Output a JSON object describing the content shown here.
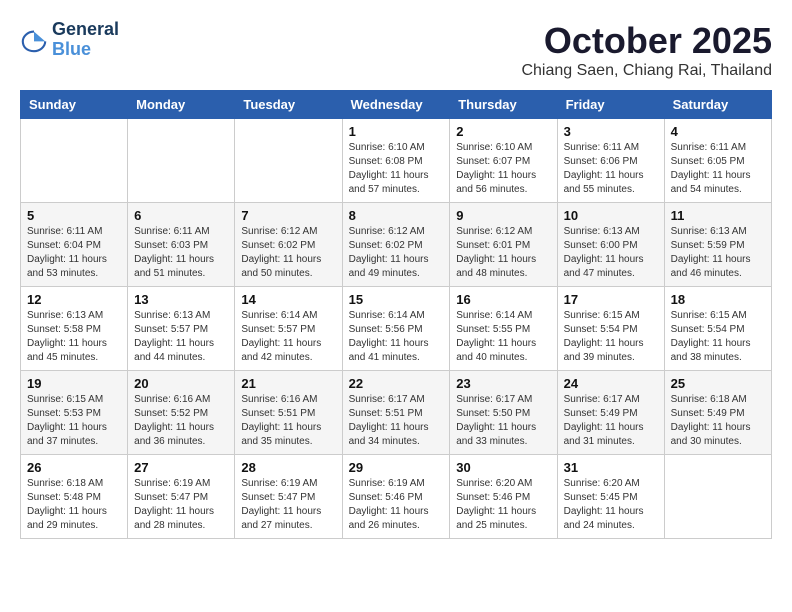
{
  "header": {
    "logo_line1": "General",
    "logo_line2": "Blue",
    "month": "October 2025",
    "location": "Chiang Saen, Chiang Rai, Thailand"
  },
  "weekdays": [
    "Sunday",
    "Monday",
    "Tuesday",
    "Wednesday",
    "Thursday",
    "Friday",
    "Saturday"
  ],
  "weeks": [
    [
      {
        "day": "",
        "text": ""
      },
      {
        "day": "",
        "text": ""
      },
      {
        "day": "",
        "text": ""
      },
      {
        "day": "1",
        "text": "Sunrise: 6:10 AM\nSunset: 6:08 PM\nDaylight: 11 hours and 57 minutes."
      },
      {
        "day": "2",
        "text": "Sunrise: 6:10 AM\nSunset: 6:07 PM\nDaylight: 11 hours and 56 minutes."
      },
      {
        "day": "3",
        "text": "Sunrise: 6:11 AM\nSunset: 6:06 PM\nDaylight: 11 hours and 55 minutes."
      },
      {
        "day": "4",
        "text": "Sunrise: 6:11 AM\nSunset: 6:05 PM\nDaylight: 11 hours and 54 minutes."
      }
    ],
    [
      {
        "day": "5",
        "text": "Sunrise: 6:11 AM\nSunset: 6:04 PM\nDaylight: 11 hours and 53 minutes."
      },
      {
        "day": "6",
        "text": "Sunrise: 6:11 AM\nSunset: 6:03 PM\nDaylight: 11 hours and 51 minutes."
      },
      {
        "day": "7",
        "text": "Sunrise: 6:12 AM\nSunset: 6:02 PM\nDaylight: 11 hours and 50 minutes."
      },
      {
        "day": "8",
        "text": "Sunrise: 6:12 AM\nSunset: 6:02 PM\nDaylight: 11 hours and 49 minutes."
      },
      {
        "day": "9",
        "text": "Sunrise: 6:12 AM\nSunset: 6:01 PM\nDaylight: 11 hours and 48 minutes."
      },
      {
        "day": "10",
        "text": "Sunrise: 6:13 AM\nSunset: 6:00 PM\nDaylight: 11 hours and 47 minutes."
      },
      {
        "day": "11",
        "text": "Sunrise: 6:13 AM\nSunset: 5:59 PM\nDaylight: 11 hours and 46 minutes."
      }
    ],
    [
      {
        "day": "12",
        "text": "Sunrise: 6:13 AM\nSunset: 5:58 PM\nDaylight: 11 hours and 45 minutes."
      },
      {
        "day": "13",
        "text": "Sunrise: 6:13 AM\nSunset: 5:57 PM\nDaylight: 11 hours and 44 minutes."
      },
      {
        "day": "14",
        "text": "Sunrise: 6:14 AM\nSunset: 5:57 PM\nDaylight: 11 hours and 42 minutes."
      },
      {
        "day": "15",
        "text": "Sunrise: 6:14 AM\nSunset: 5:56 PM\nDaylight: 11 hours and 41 minutes."
      },
      {
        "day": "16",
        "text": "Sunrise: 6:14 AM\nSunset: 5:55 PM\nDaylight: 11 hours and 40 minutes."
      },
      {
        "day": "17",
        "text": "Sunrise: 6:15 AM\nSunset: 5:54 PM\nDaylight: 11 hours and 39 minutes."
      },
      {
        "day": "18",
        "text": "Sunrise: 6:15 AM\nSunset: 5:54 PM\nDaylight: 11 hours and 38 minutes."
      }
    ],
    [
      {
        "day": "19",
        "text": "Sunrise: 6:15 AM\nSunset: 5:53 PM\nDaylight: 11 hours and 37 minutes."
      },
      {
        "day": "20",
        "text": "Sunrise: 6:16 AM\nSunset: 5:52 PM\nDaylight: 11 hours and 36 minutes."
      },
      {
        "day": "21",
        "text": "Sunrise: 6:16 AM\nSunset: 5:51 PM\nDaylight: 11 hours and 35 minutes."
      },
      {
        "day": "22",
        "text": "Sunrise: 6:17 AM\nSunset: 5:51 PM\nDaylight: 11 hours and 34 minutes."
      },
      {
        "day": "23",
        "text": "Sunrise: 6:17 AM\nSunset: 5:50 PM\nDaylight: 11 hours and 33 minutes."
      },
      {
        "day": "24",
        "text": "Sunrise: 6:17 AM\nSunset: 5:49 PM\nDaylight: 11 hours and 31 minutes."
      },
      {
        "day": "25",
        "text": "Sunrise: 6:18 AM\nSunset: 5:49 PM\nDaylight: 11 hours and 30 minutes."
      }
    ],
    [
      {
        "day": "26",
        "text": "Sunrise: 6:18 AM\nSunset: 5:48 PM\nDaylight: 11 hours and 29 minutes."
      },
      {
        "day": "27",
        "text": "Sunrise: 6:19 AM\nSunset: 5:47 PM\nDaylight: 11 hours and 28 minutes."
      },
      {
        "day": "28",
        "text": "Sunrise: 6:19 AM\nSunset: 5:47 PM\nDaylight: 11 hours and 27 minutes."
      },
      {
        "day": "29",
        "text": "Sunrise: 6:19 AM\nSunset: 5:46 PM\nDaylight: 11 hours and 26 minutes."
      },
      {
        "day": "30",
        "text": "Sunrise: 6:20 AM\nSunset: 5:46 PM\nDaylight: 11 hours and 25 minutes."
      },
      {
        "day": "31",
        "text": "Sunrise: 6:20 AM\nSunset: 5:45 PM\nDaylight: 11 hours and 24 minutes."
      },
      {
        "day": "",
        "text": ""
      }
    ]
  ]
}
